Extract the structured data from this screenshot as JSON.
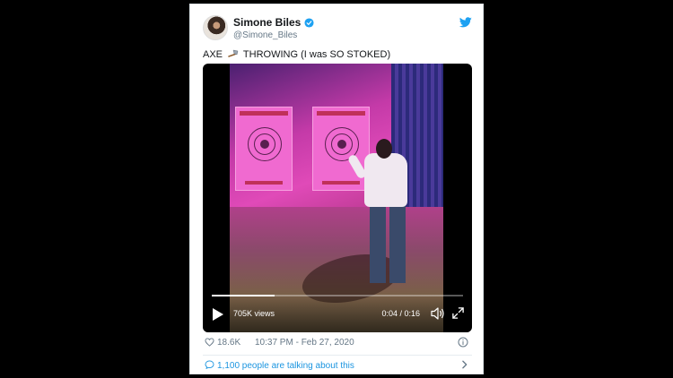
{
  "tweet": {
    "author": {
      "display_name": "Simone Biles",
      "handle": "@Simone_Biles",
      "verified": true,
      "avatar_icon": "avatar"
    },
    "text_before_icon": "AXE ",
    "text_icon": "axe-icon",
    "text_after_icon": " THROWING (I was SO STOKED)",
    "video": {
      "views": "705K views",
      "timecode": "0:04 / 0:16",
      "progress_fraction": 0.25
    },
    "likes": "18.6K",
    "timestamp": "10:37 PM - Feb 27, 2020",
    "talking": "1,100 people are talking about this"
  },
  "colors": {
    "brand_blue": "#1da1f2",
    "link_blue": "#1b95e0",
    "text_primary": "#14171a",
    "text_secondary": "#657786",
    "page_background": "#000000"
  },
  "icons": {
    "verified": "verified-badge-icon",
    "logo": "twitter-bird-icon",
    "play": "play-icon",
    "volume": "volume-icon",
    "fullscreen": "fullscreen-icon",
    "like": "heart-icon",
    "info": "info-icon",
    "talking": "speech-bubble-icon",
    "more": "chevron-right-icon"
  }
}
